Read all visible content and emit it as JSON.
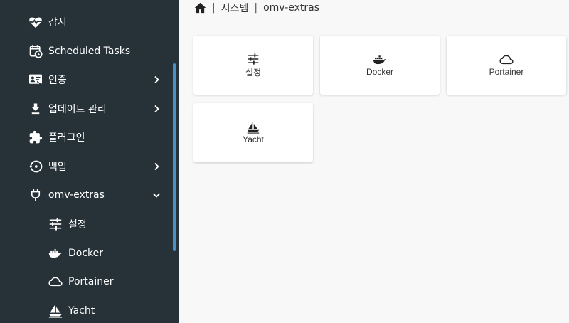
{
  "breadcrumb": {
    "home_icon": "home-icon",
    "items": [
      "시스템",
      "omv-extras"
    ]
  },
  "sidebar": {
    "items": [
      {
        "label": "감시",
        "icon": "heart-pulse-icon",
        "chevron": "none"
      },
      {
        "label": "Scheduled Tasks",
        "icon": "calendar-clock-icon",
        "chevron": "none"
      },
      {
        "label": "인증",
        "icon": "badge-account-icon",
        "chevron": "right"
      },
      {
        "label": "업데이트 관리",
        "icon": "download-icon",
        "chevron": "right"
      },
      {
        "label": "플러그인",
        "icon": "puzzle-icon",
        "chevron": "none"
      },
      {
        "label": "백업",
        "icon": "backup-restore-icon",
        "chevron": "right"
      },
      {
        "label": "omv-extras",
        "icon": "power-plug-icon",
        "chevron": "down"
      }
    ],
    "subitems": [
      {
        "label": "설정",
        "icon": "tune-icon"
      },
      {
        "label": "Docker",
        "icon": "docker-icon"
      },
      {
        "label": "Portainer",
        "icon": "cloud-outline-icon"
      },
      {
        "label": "Yacht",
        "icon": "sailboat-icon"
      }
    ]
  },
  "cards": [
    {
      "label": "설정",
      "icon": "tune-icon"
    },
    {
      "label": "Docker",
      "icon": "docker-icon"
    },
    {
      "label": "Portainer",
      "icon": "cloud-outline-icon"
    },
    {
      "label": "Yacht",
      "icon": "sailboat-icon"
    }
  ],
  "colors": {
    "sidebar_bg": "#263238",
    "scrollbar": "#4a90c8",
    "content_bg": "#f8f8f8",
    "card_bg": "#ffffff"
  }
}
